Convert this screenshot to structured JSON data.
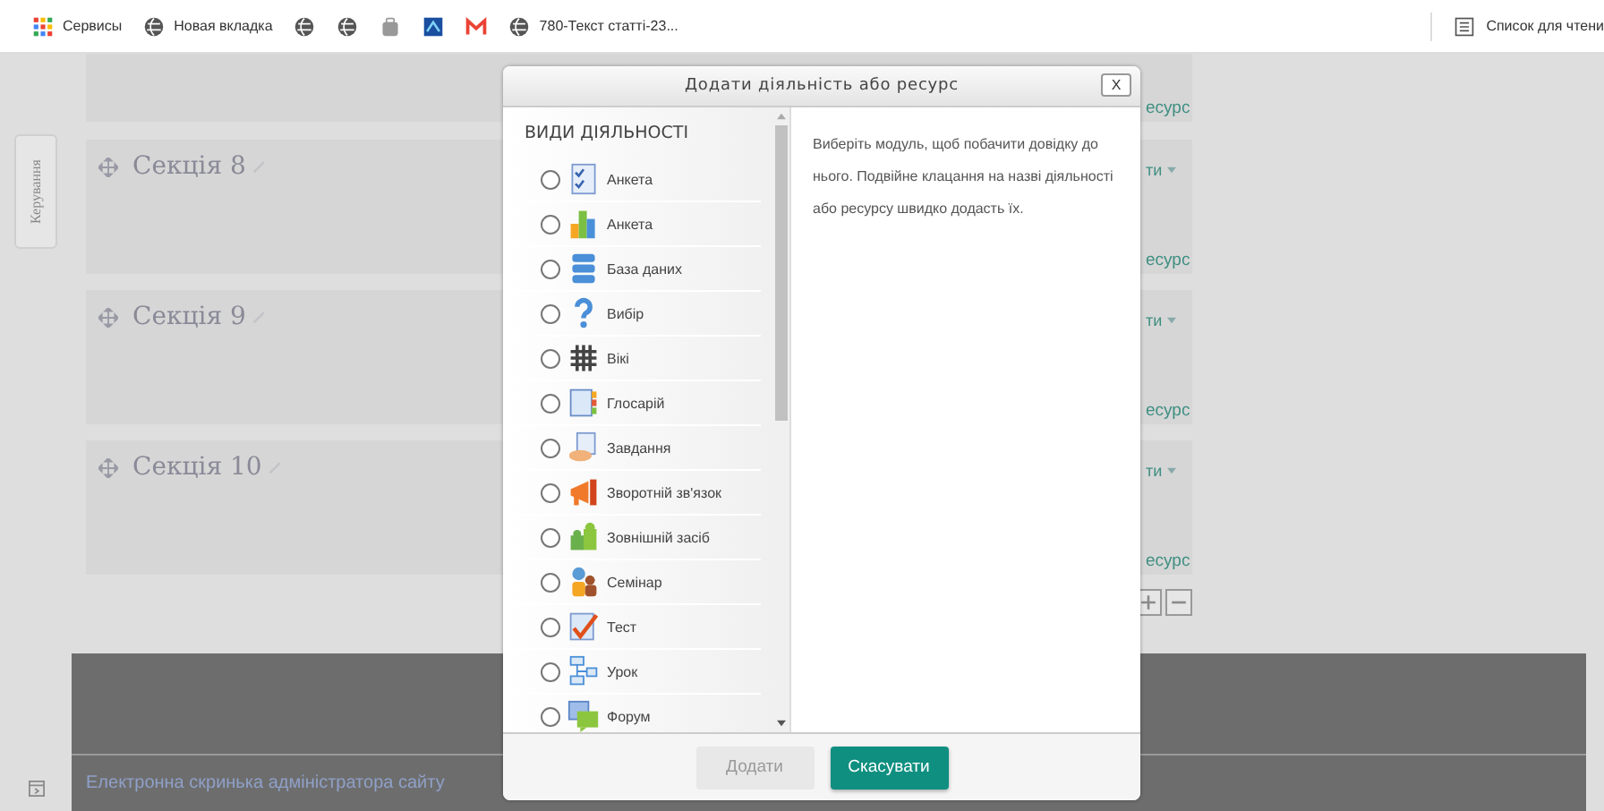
{
  "bookmarks_bar": {
    "items": [
      {
        "kind": "apps",
        "label": "Сервисы"
      },
      {
        "kind": "globe",
        "label": "Новая вкладка"
      },
      {
        "kind": "globe"
      },
      {
        "kind": "globe"
      },
      {
        "kind": "bag"
      },
      {
        "kind": "app"
      },
      {
        "kind": "mail"
      },
      {
        "kind": "globe",
        "label": "780-Текст статті-23..."
      }
    ],
    "reading_list": "Список для чтени"
  },
  "side_tab": "Керування",
  "sections": [
    {
      "resource": "есурс"
    },
    {
      "title": "Секція 8",
      "action": "ти",
      "resource": "есурс"
    },
    {
      "title": "Секція 9",
      "action": "ти",
      "resource": "есурс"
    },
    {
      "title": "Секція 10",
      "action": "ти",
      "resource": "есурс"
    }
  ],
  "footer": {
    "link": "Електронна скринька адміністратора сайту"
  },
  "dialog": {
    "title": "Додати діяльність або ресурс",
    "close": "X",
    "list_heading": "ВИДИ ДІЯЛЬНОСТІ",
    "items": [
      {
        "label": "Анкета",
        "selected": false
      },
      {
        "label": "Анкета",
        "selected": false
      },
      {
        "label": "База даних",
        "selected": false
      },
      {
        "label": "Вибір",
        "selected": false
      },
      {
        "label": "Вікі",
        "selected": false
      },
      {
        "label": "Глосарій",
        "selected": false
      },
      {
        "label": "Завдання",
        "selected": false
      },
      {
        "label": "Зворотній зв'язок",
        "selected": false
      },
      {
        "label": "Зовнішній засіб",
        "selected": false
      },
      {
        "label": "Семінар",
        "selected": false
      },
      {
        "label": "Тест",
        "selected": false
      },
      {
        "label": "Урок",
        "selected": false
      },
      {
        "label": "Форум",
        "selected": false
      }
    ],
    "help": "Виберіть модуль, щоб побачити довідку до нього. Подвійне клацання на назві діяльності або ресурсу швидко додасть їх.",
    "buttons": [
      {
        "label": "Додати",
        "disabled": true
      },
      {
        "label": "Скасувати",
        "disabled": false
      }
    ]
  }
}
